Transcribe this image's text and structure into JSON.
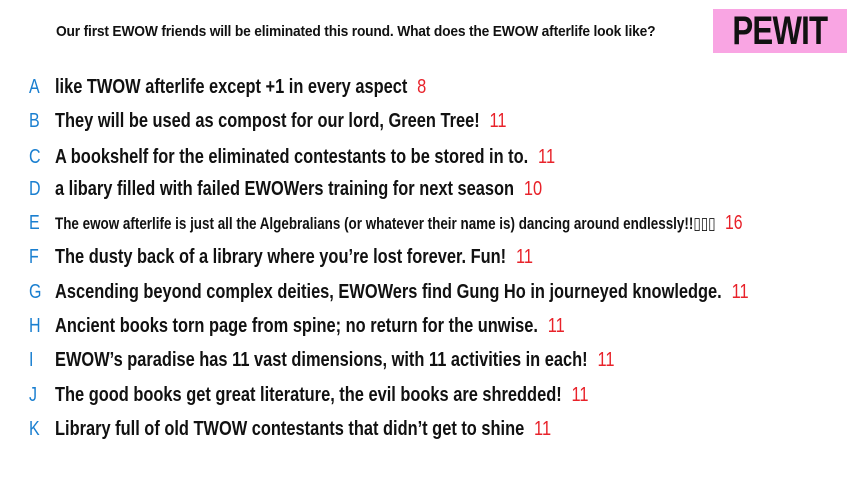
{
  "prompt": "Our first EWOW friends will be eliminated this round. What does the EWOW afterlife look like?",
  "logo": "PEWIT",
  "colors": {
    "letter": "#1a7fd0",
    "score": "#e8222a",
    "logo_bg": "#f9a5e3"
  },
  "responses": [
    {
      "letter": "A",
      "text": "like TWOW afterlife except +1 in every aspect",
      "score": "8"
    },
    {
      "letter": "B",
      "text": "They will be used as compost for our lord, Green Tree!",
      "score": "11"
    },
    {
      "letter": "C",
      "text": "A bookshelf for the eliminated contestants to be stored in to.",
      "score": "11"
    },
    {
      "letter": "D",
      "text": "a libary filled with failed EWOWers training for next season",
      "score": "10"
    },
    {
      "letter": "E",
      "text": "The ewow afterlife is just all the Algebralians (or whatever their name is) dancing around endlessly!!▯▯▯",
      "score": "16"
    },
    {
      "letter": "F",
      "text": "The dusty back of a library where you’re lost forever. Fun!",
      "score": "11"
    },
    {
      "letter": "G",
      "text": "Ascending beyond complex deities, EWOWers find Gung Ho in journeyed knowledge.",
      "score": "11"
    },
    {
      "letter": "H",
      "text": "Ancient books torn page from spine; no return for the unwise.",
      "score": "11"
    },
    {
      "letter": "I",
      "text": "EWOW’s paradise has 11 vast dimensions, with 11 activities in each!",
      "score": "11"
    },
    {
      "letter": "J",
      "text": "The good books get great literature, the evil books are shredded!",
      "score": "11"
    },
    {
      "letter": "K",
      "text": "Library full of old TWOW contestants that didn’t get to shine",
      "score": "11"
    }
  ]
}
